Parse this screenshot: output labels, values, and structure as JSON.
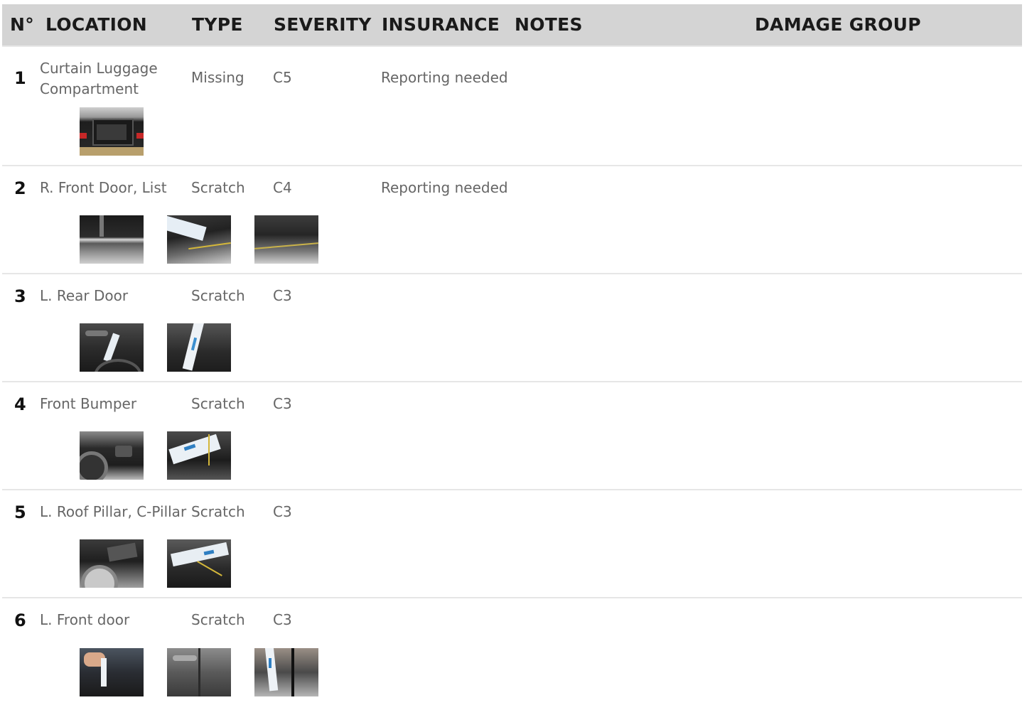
{
  "header": {
    "no": "N°",
    "location": "LOCATION",
    "type": "TYPE",
    "severity": "SEVERITY",
    "insurance": "INSURANCE",
    "notes": "NOTES",
    "damage_group": "DAMAGE GROUP"
  },
  "rows": [
    {
      "no": "1",
      "location_line1": "Curtain Luggage",
      "location_line2": "Compartment",
      "type": "Missing",
      "severity": "C5",
      "insurance": "Reporting needed",
      "notes": "",
      "damage_group": "",
      "photos": [
        "luggage-compartment-photo"
      ]
    },
    {
      "no": "2",
      "location": "R. Front Door, List",
      "type": "Scratch",
      "severity": "C4",
      "insurance": "Reporting needed",
      "notes": "",
      "damage_group": "",
      "photos": [
        "door-side-photo",
        "scratch-gauge-photo",
        "door-panel-closeup-photo"
      ]
    },
    {
      "no": "3",
      "location": "L. Rear Door",
      "type": "Scratch",
      "severity": "C3",
      "insurance": "",
      "notes": "",
      "damage_group": "",
      "photos": [
        "rear-door-handle-photo",
        "rear-door-gauge-photo"
      ]
    },
    {
      "no": "4",
      "location": "Front Bumper",
      "type": "Scratch",
      "severity": "C3",
      "insurance": "",
      "notes": "",
      "damage_group": "",
      "photos": [
        "front-bumper-photo",
        "bumper-gauge-photo"
      ]
    },
    {
      "no": "5",
      "location": "L. Roof Pillar, C-Pillar",
      "type": "Scratch",
      "severity": "C3",
      "insurance": "",
      "notes": "",
      "damage_group": "",
      "photos": [
        "c-pillar-wheel-photo",
        "c-pillar-gauge-photo"
      ]
    },
    {
      "no": "6",
      "location": "L. Front door",
      "type": "Scratch",
      "severity": "C3",
      "insurance": "",
      "notes": "",
      "damage_group": "",
      "photos": [
        "front-door-hand-photo",
        "front-door-handle-photo",
        "front-door-gauge-photo"
      ]
    }
  ],
  "colors": {
    "header_bg": "#d4d4d4",
    "header_text": "#1a1a1a",
    "cell_text": "#666666",
    "row_divider": "#e6e6e6"
  }
}
